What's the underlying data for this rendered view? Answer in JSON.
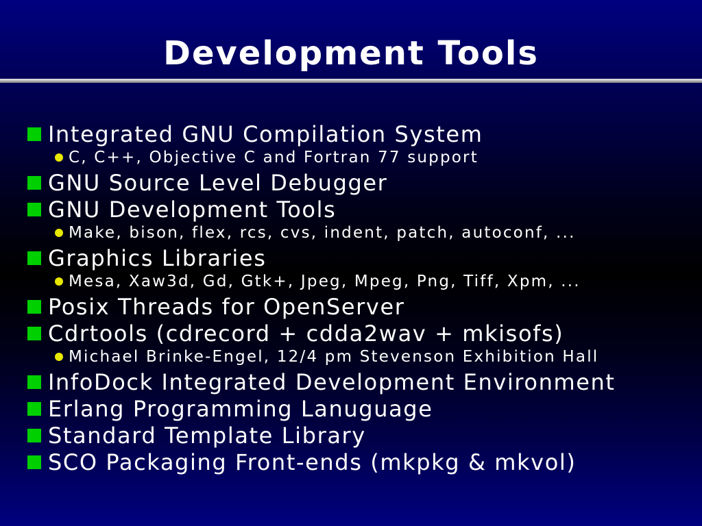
{
  "slide": {
    "title": "Development Tools"
  },
  "colors": {
    "main_bullet": "#00d000",
    "sub_bullet": "#e8e800",
    "title_rule": "#b8b8b8",
    "background_top": "#000080",
    "background_middle": "#000000",
    "text": "#ffffff"
  },
  "bullets": [
    {
      "level": 1,
      "text": "Integrated GNU Compilation System"
    },
    {
      "level": 2,
      "text": "C, C++, Objective C and Fortran 77 support"
    },
    {
      "level": 1,
      "text": "GNU Source Level Debugger"
    },
    {
      "level": 1,
      "text": "GNU Development Tools"
    },
    {
      "level": 2,
      "text": "Make, bison, flex, rcs, cvs, indent, patch, autoconf, ..."
    },
    {
      "level": 1,
      "text": "Graphics Libraries"
    },
    {
      "level": 2,
      "text": "Mesa, Xaw3d, Gd, Gtk+, Jpeg, Mpeg, Png, Tiff, Xpm, ..."
    },
    {
      "level": 1,
      "text": "Posix Threads for OpenServer"
    },
    {
      "level": 1,
      "text": "Cdrtools (cdrecord + cdda2wav + mkisofs)"
    },
    {
      "level": 2,
      "text": "Michael Brinke-Engel, 12/4 pm Stevenson Exhibition Hall"
    },
    {
      "level": 1,
      "text": "InfoDock Integrated Development Environment"
    },
    {
      "level": 1,
      "text": "Erlang Programming Lanuguage"
    },
    {
      "level": 1,
      "text": "Standard Template Library"
    },
    {
      "level": 1,
      "text": "SCO Packaging Front-ends (mkpkg & mkvol)"
    }
  ]
}
